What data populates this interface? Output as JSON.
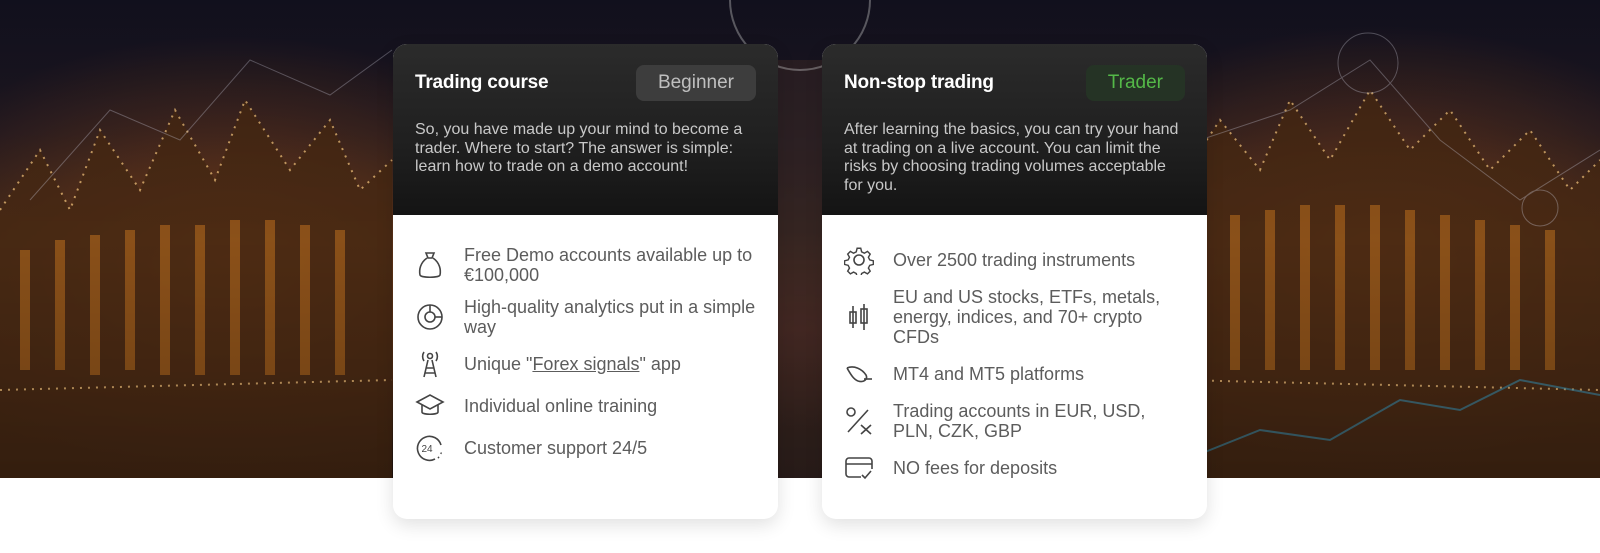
{
  "cards": [
    {
      "title": "Trading course",
      "badge": "Beginner",
      "description": "So, you have made up your mind to become a trader. Where to start? The answer is simple: learn how to trade on a demo account!",
      "features": [
        {
          "icon": "money-bag-icon",
          "text": "Free Demo accounts available up to €100,000"
        },
        {
          "icon": "analytics-chart-icon",
          "text": "High-quality analytics put in a simple way"
        },
        {
          "icon": "signal-tower-icon",
          "text_before": "Unique \"",
          "link": "Forex signals",
          "text_after": "\" app"
        },
        {
          "icon": "graduation-cap-icon",
          "text": "Individual online training"
        },
        {
          "icon": "support-24-icon",
          "text": "Customer support 24/5",
          "icon_label": "24"
        }
      ]
    },
    {
      "title": "Non-stop trading",
      "badge": "Trader",
      "description": "After learning the basics, you can try your hand at trading on a live account. You can limit the risks by choosing trading volumes acceptable for you.",
      "features": [
        {
          "icon": "gear-icon",
          "text": "Over 2500 trading instruments"
        },
        {
          "icon": "candlestick-icon",
          "text": "EU and US stocks, ETFs, metals, energy, indices, and 70+ crypto CFDs"
        },
        {
          "icon": "platform-icon",
          "text": "MT4 and MT5 platforms"
        },
        {
          "icon": "currency-percent-icon",
          "text": "Trading accounts in EUR, USD, PLN, CZK, GBP"
        },
        {
          "icon": "card-check-icon",
          "text": "NO fees for deposits"
        }
      ]
    }
  ],
  "colors": {
    "card_head_bg": "#1f1f1f",
    "badge_beginner_bg": "#3d3d3d",
    "badge_beginner_text": "#bfbfbf",
    "badge_trader_bg": "#253325",
    "badge_trader_text": "#54b848",
    "feature_text": "#5c5c5c"
  }
}
